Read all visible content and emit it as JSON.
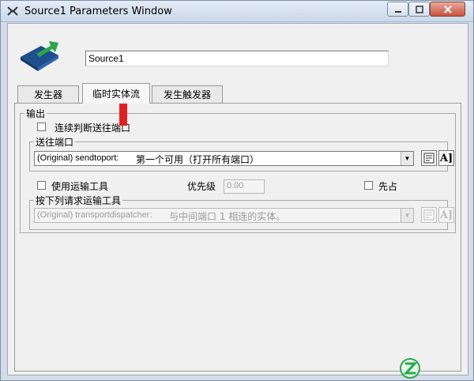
{
  "window": {
    "title": "Source1  Parameters Window",
    "controls": {
      "minimize": "—",
      "maximize": "□",
      "close": "✕"
    }
  },
  "object": {
    "name_value": "Source1"
  },
  "tabs": [
    {
      "label": "发生器",
      "selected": false
    },
    {
      "label": "临时实体流",
      "selected": true
    },
    {
      "label": "发生触发器",
      "selected": false
    }
  ],
  "output": {
    "group_label": "输出",
    "continuous_check_label": "连续判断送往端口",
    "send_to_port": {
      "group_label": "送往端口",
      "prefix": "(Original) sendtoport:",
      "value": "第一个可用（打开所有端口）"
    },
    "use_transport_label": "使用运输工具",
    "priority_label": "优先级",
    "priority_value": "0.00",
    "preempt_label": "先占",
    "request_transport": {
      "group_label": "按下列请求运输工具",
      "prefix": "(Original) transportdispatcher:",
      "value": "与中间端口 1  相连的实体。"
    }
  },
  "icons": {
    "app": "flexsim-icon",
    "logo": "source-object-icon",
    "edit": "code-edit-icon",
    "template": "template-text-icon",
    "annotation": "red-up-arrow",
    "watermark": "z-logo-watermark"
  },
  "colors": {
    "annotation": "#e02020",
    "accent": "#2aa84a"
  },
  "watermark": {
    "text": ""
  }
}
